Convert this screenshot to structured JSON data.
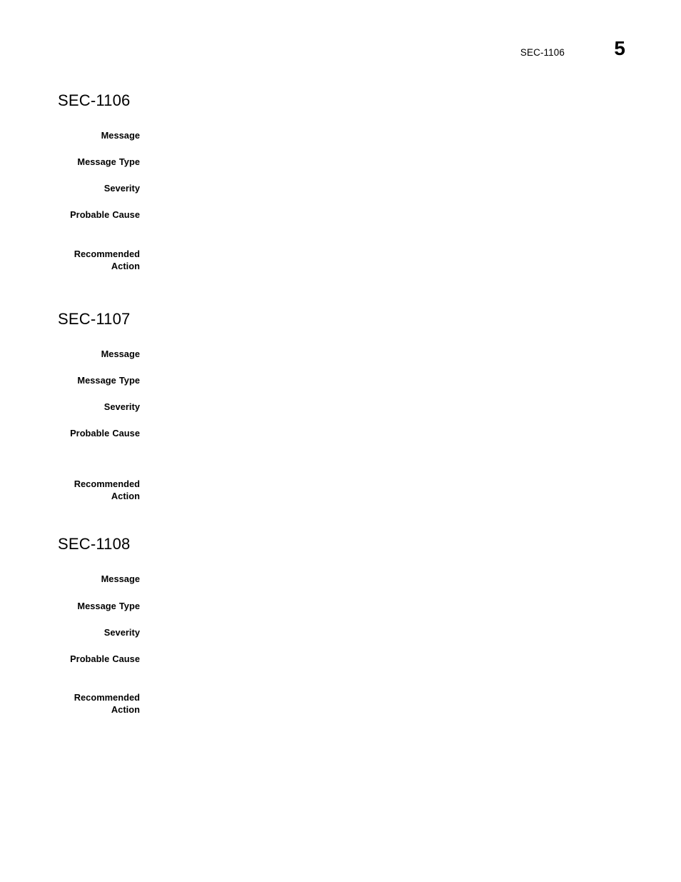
{
  "header": {
    "running_title": "SEC-1106",
    "page_number": "5"
  },
  "sections": [
    {
      "heading": "SEC-1106",
      "fields": [
        {
          "label": "Message",
          "value": ""
        },
        {
          "label": "Message Type",
          "value": ""
        },
        {
          "label": "Severity",
          "value": ""
        },
        {
          "label": "Probable Cause",
          "value": ""
        },
        {
          "label": "Recommended Action",
          "value": ""
        }
      ]
    },
    {
      "heading": "SEC-1107",
      "fields": [
        {
          "label": "Message",
          "value": ""
        },
        {
          "label": "Message Type",
          "value": ""
        },
        {
          "label": "Severity",
          "value": ""
        },
        {
          "label": "Probable Cause",
          "value": ""
        },
        {
          "label": "Recommended Action",
          "value": ""
        }
      ]
    },
    {
      "heading": "SEC-1108",
      "fields": [
        {
          "label": "Message",
          "value": ""
        },
        {
          "label": "Message Type",
          "value": ""
        },
        {
          "label": "Severity",
          "value": ""
        },
        {
          "label": "Probable Cause",
          "value": ""
        },
        {
          "label": "Recommended Action",
          "value": ""
        }
      ]
    }
  ]
}
